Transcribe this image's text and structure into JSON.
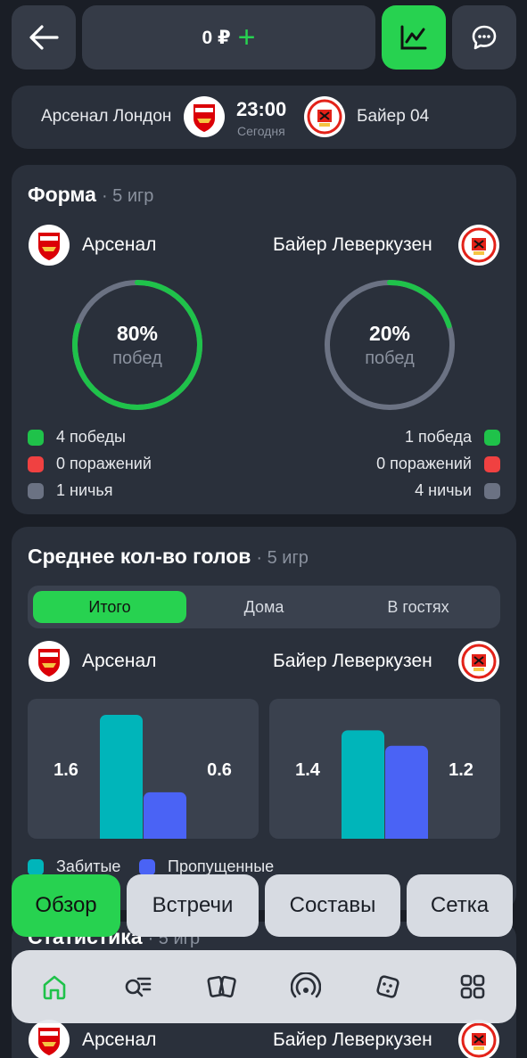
{
  "header": {
    "balance": "0 ₽",
    "plus": "+"
  },
  "match": {
    "home_team": "Арсенал Лондон",
    "away_team": "Байер 04",
    "time": "23:00",
    "day": "Сегодня"
  },
  "form": {
    "title": "Форма",
    "subtitle": "· 5 игр",
    "home": {
      "name": "Арсенал",
      "percent": "80%",
      "percent_value": 0.8,
      "label": "побед",
      "wins": "4 победы",
      "losses": "0 поражений",
      "draws": "1 ничья"
    },
    "away": {
      "name": "Байер Леверкузен",
      "percent": "20%",
      "percent_value": 0.2,
      "label": "побед",
      "wins": "1 победа",
      "losses": "0 поражений",
      "draws": "4 ничьи"
    }
  },
  "goals": {
    "title": "Среднее кол-во голов",
    "subtitle": "· 5 игр",
    "tabs": [
      "Итого",
      "Дома",
      "В гостях"
    ],
    "active_tab": "Итого",
    "home_name": "Арсенал",
    "away_name": "Байер Леверкузен",
    "legend_scored": "Забитые",
    "legend_conceded": "Пропущенные"
  },
  "chart_data": [
    {
      "type": "bar",
      "team": "Арсенал",
      "categories": [
        "Забитые",
        "Пропущенные"
      ],
      "values": [
        1.6,
        0.6
      ],
      "labels": [
        "1.6",
        "0.6"
      ],
      "ylim": [
        0,
        1.6
      ]
    },
    {
      "type": "bar",
      "team": "Байер Леверкузен",
      "categories": [
        "Забитые",
        "Пропущенные"
      ],
      "values": [
        1.4,
        1.2
      ],
      "labels": [
        "1.4",
        "1.2"
      ],
      "ylim": [
        0,
        1.4
      ]
    }
  ],
  "stats": {
    "title": "Статистика",
    "subtitle": "· 5 игр",
    "home_name": "Арсенал",
    "away_name": "Байер Леверкузен"
  },
  "tabs_bar": [
    "Обзор",
    "Встречи",
    "Составы",
    "Сетка"
  ],
  "bottom_nav": [
    "home-icon",
    "search-list-icon",
    "cards-icon",
    "live-broadcast-icon",
    "dice-icon",
    "apps-grid-icon"
  ],
  "colors": {
    "accent": "#27d250",
    "loss": "#f04141",
    "draw": "#6b7283",
    "scored": "#00b5ba",
    "conceded": "#4a63f5"
  }
}
